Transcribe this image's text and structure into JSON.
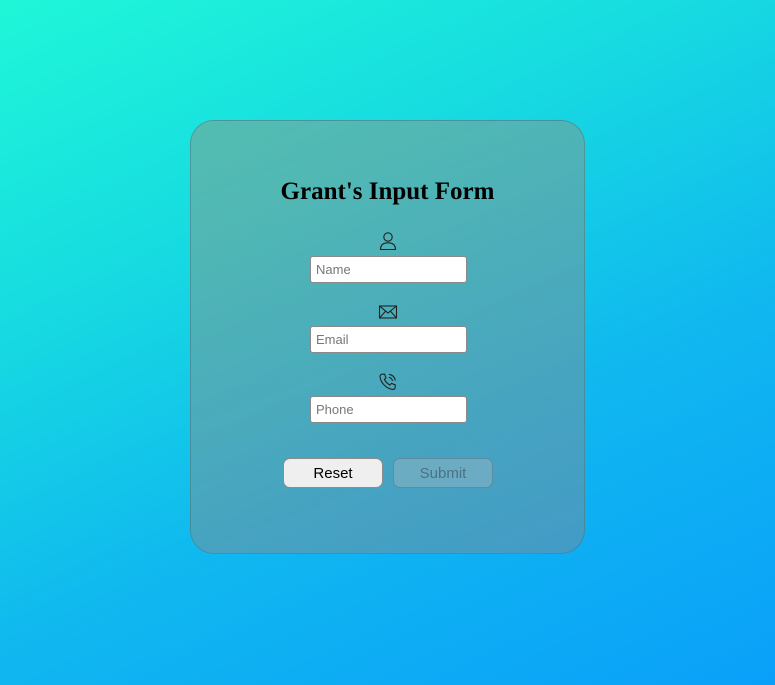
{
  "form": {
    "title": "Grant's Input Form",
    "fields": [
      {
        "icon": "person-icon",
        "placeholder": "Name",
        "value": ""
      },
      {
        "icon": "envelope-icon",
        "placeholder": "Email",
        "value": ""
      },
      {
        "icon": "phone-icon",
        "placeholder": "Phone",
        "value": ""
      }
    ],
    "buttons": {
      "reset_label": "Reset",
      "submit_label": "Submit",
      "submit_disabled": true
    }
  }
}
